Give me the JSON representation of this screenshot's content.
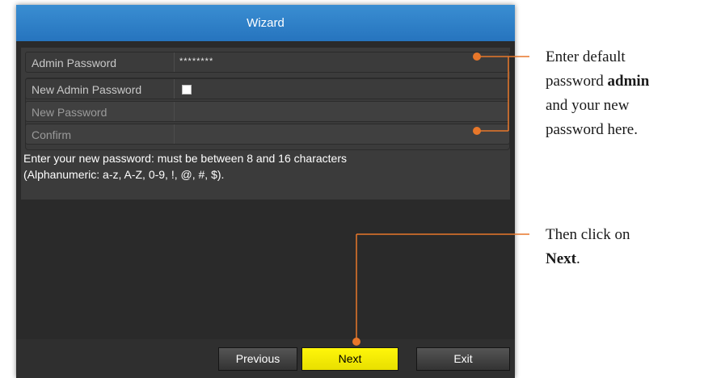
{
  "window": {
    "title": "Wizard"
  },
  "fields": {
    "admin_password": {
      "label": "Admin Password",
      "value": "********"
    },
    "new_admin_password": {
      "label": "New Admin Password",
      "checked": false
    },
    "new_password": {
      "label": "New Password",
      "value": ""
    },
    "confirm": {
      "label": "Confirm",
      "value": ""
    }
  },
  "hint": {
    "line1": "Enter your new password: must be between 8 and 16 characters",
    "line2": "(Alphanumeric: a-z, A-Z, 0-9, !, @, #, $)."
  },
  "buttons": {
    "previous": "Previous",
    "next": "Next",
    "exit": "Exit"
  },
  "annotations": {
    "top_line1": "Enter default",
    "top_line2_pre": "password ",
    "top_line2_bold": "admin",
    "top_line3": "and your new",
    "top_line4": "password here.",
    "bottom_line1": "Then click on",
    "bottom_line2_bold": "Next",
    "bottom_line2_post": "."
  },
  "colors": {
    "accent_orange": "#e8772a",
    "title_blue": "#2f82c8",
    "next_yellow": "#fff200"
  }
}
